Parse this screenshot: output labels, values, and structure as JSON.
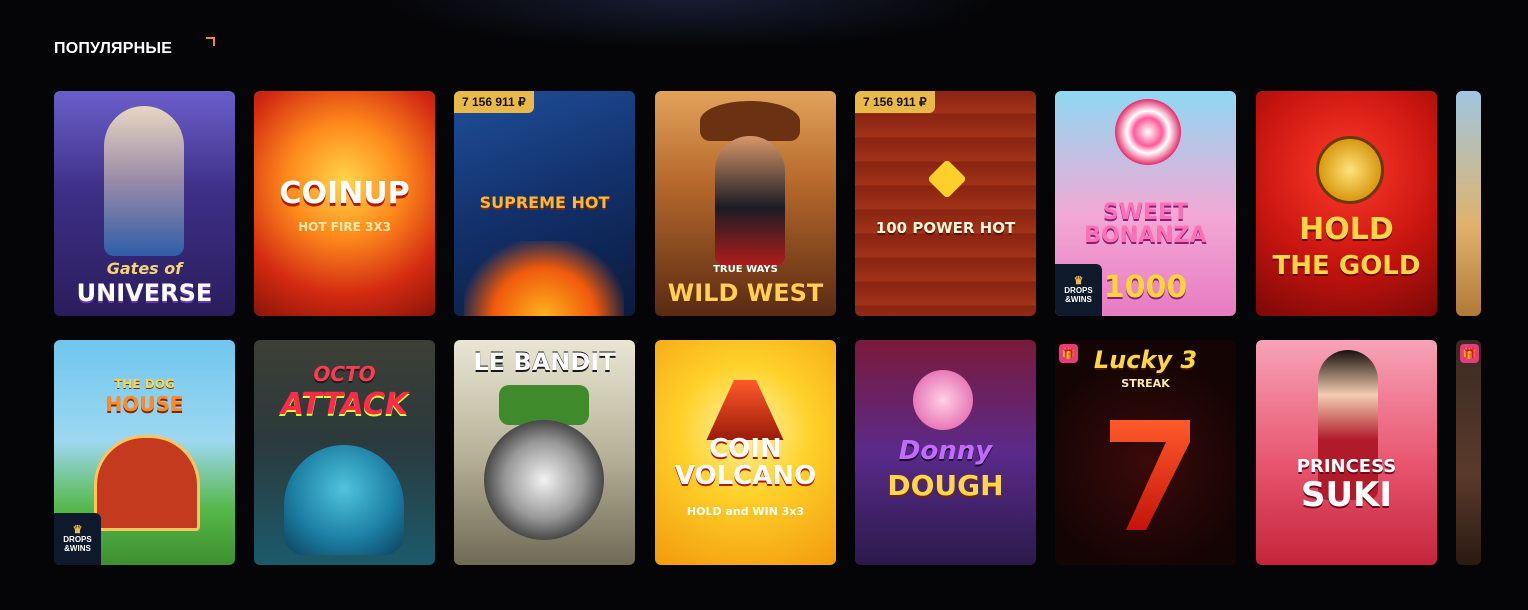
{
  "section": {
    "title": "ПОПУЛЯРНЫЕ"
  },
  "badges": {
    "jackpot": "7 156 911 ₽",
    "drops_line1": "DROPS",
    "drops_line2": "&WINS"
  },
  "games_row1": [
    {
      "title_a": "Gates of",
      "title_b": "UNIVERSE"
    },
    {
      "title_a": "COINUP",
      "title_b": "HOT FIRE 3x3"
    },
    {
      "title_a": "SUPREME HOT",
      "title_b": ""
    },
    {
      "title_a": "TRUE WAYS",
      "title_b": "WILD WEST"
    },
    {
      "title_a": "100 POWER HOT",
      "title_b": ""
    },
    {
      "title_a": "SWEET BONANZA",
      "title_b": "1000"
    },
    {
      "title_a": "HOLD",
      "title_b": "THE GOLD"
    }
  ],
  "games_row2": [
    {
      "title_a": "THE DOG",
      "title_b": "HOUSE"
    },
    {
      "title_a": "OCTO",
      "title_b": "ATTACK"
    },
    {
      "title_a": "LE BANDIT",
      "title_b": ""
    },
    {
      "title_a": "COIN VOLCANO",
      "title_b": "HOLD and WIN 3x3"
    },
    {
      "title_a": "Donny",
      "title_b": "DOUGH"
    },
    {
      "title_a": "Lucky 3",
      "title_b": "STREAK"
    },
    {
      "title_a": "PRINCESS",
      "title_b": "SUKI"
    }
  ],
  "icons": {
    "gift": "gift-icon",
    "crown": "crown-icon",
    "corner": "corner-accent-icon"
  },
  "colors": {
    "background": "#050507",
    "accent": "#e8893a",
    "jackpot_bg": "#e9b949",
    "gift_bg": "#e63c7a"
  }
}
